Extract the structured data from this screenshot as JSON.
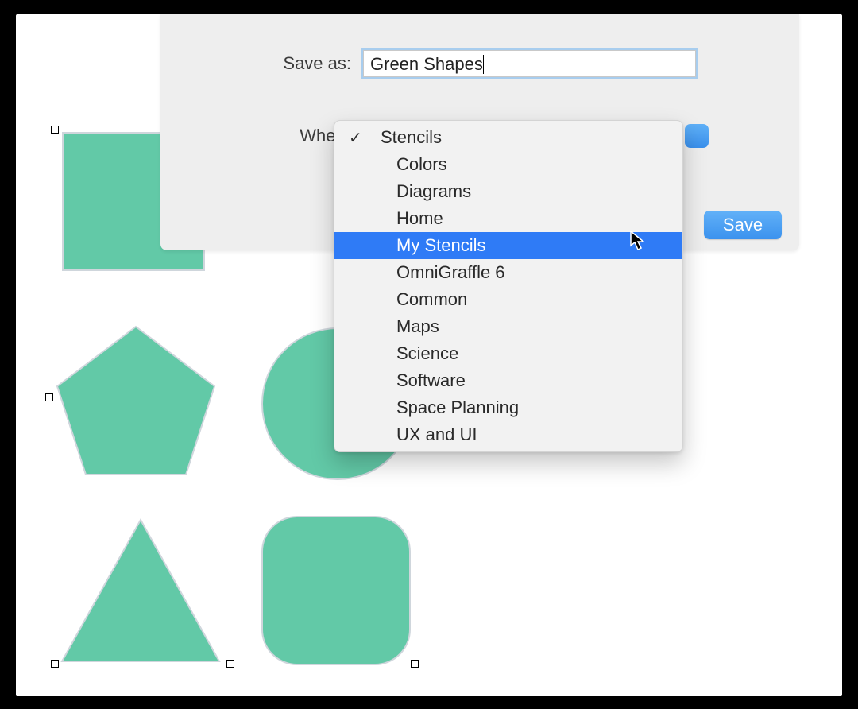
{
  "dialog": {
    "save_as_label": "Save as:",
    "filename_value": "Green Shapes",
    "where_label": "Where",
    "save_button": "Save"
  },
  "dropdown": {
    "checked_index": 0,
    "highlighted_index": 4,
    "items": [
      {
        "label": "Stencils",
        "indent": false
      },
      {
        "label": "Colors",
        "indent": true
      },
      {
        "label": "Diagrams",
        "indent": true
      },
      {
        "label": "Home",
        "indent": true
      },
      {
        "label": "My Stencils",
        "indent": true
      },
      {
        "label": "OmniGraffle 6",
        "indent": true
      },
      {
        "label": "Common",
        "indent": true
      },
      {
        "label": "Maps",
        "indent": true
      },
      {
        "label": "Science",
        "indent": true
      },
      {
        "label": "Software",
        "indent": true
      },
      {
        "label": "Space Planning",
        "indent": true
      },
      {
        "label": "UX and UI",
        "indent": true
      }
    ]
  },
  "canvas": {
    "shape_fill": "#62c9a7",
    "shape_stroke": "#cfd6dc",
    "shapes": [
      "square",
      "pentagon",
      "circle",
      "triangle",
      "rounded-square"
    ],
    "handles_visible": true
  }
}
